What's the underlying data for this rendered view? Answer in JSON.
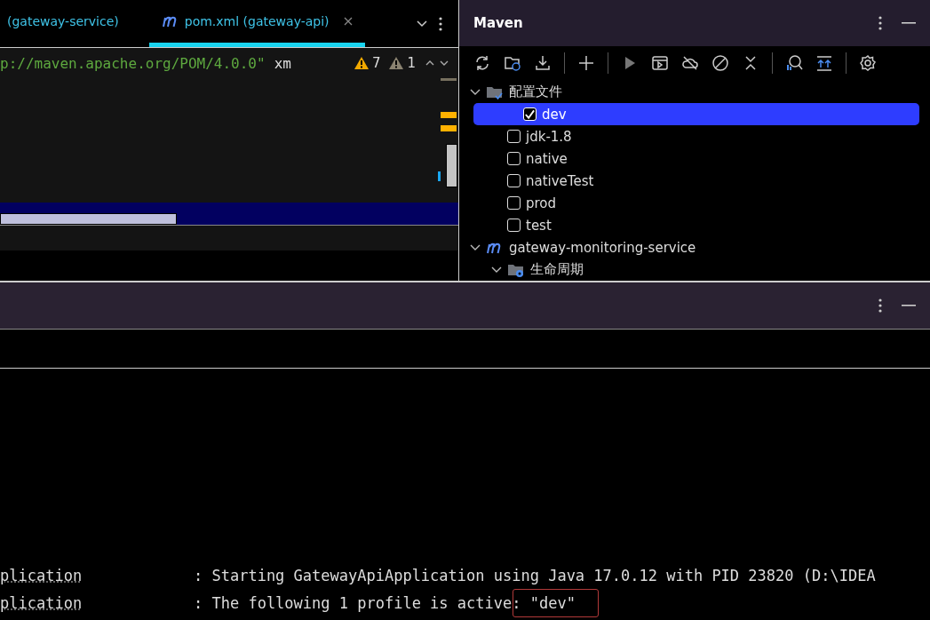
{
  "editor_tabs": [
    {
      "label": "(gateway-service)",
      "selected": false,
      "maven_icon": false
    },
    {
      "label": "pom.xml (gateway-api)",
      "selected": true,
      "maven_icon": true
    }
  ],
  "editor": {
    "code": "p://maven.apache.org/POM/4.0.0\"",
    "code_tail": "xm",
    "warnings": "7",
    "weak_warnings": "1"
  },
  "maven": {
    "title": "Maven",
    "tree": [
      {
        "label": "配置文件",
        "kind": "profiles",
        "expanded": true,
        "children": [
          {
            "label": "dev",
            "kind": "profile",
            "checked": true,
            "selected": true
          },
          {
            "label": "jdk-1.8",
            "kind": "profile",
            "checked": false,
            "selected": false
          },
          {
            "label": "native",
            "kind": "profile",
            "checked": false,
            "selected": false
          },
          {
            "label": "nativeTest",
            "kind": "profile",
            "checked": false,
            "selected": false
          },
          {
            "label": "prod",
            "kind": "profile",
            "checked": false,
            "selected": false
          },
          {
            "label": "test",
            "kind": "profile",
            "checked": false,
            "selected": false
          }
        ]
      },
      {
        "label": "gateway-monitoring-service",
        "kind": "module",
        "expanded": true,
        "children": [
          {
            "label": "生命周期",
            "kind": "lifecycle",
            "expanded": true
          }
        ]
      }
    ]
  },
  "console": {
    "lines": [
      {
        "logger": "plication",
        "message": ": Starting GatewayApiApplication using Java 17.0.12 with PID 23820 (D:\\IDEA",
        "highlighted": false
      },
      {
        "logger": "plication",
        "message": ": The following 1 profile is active: \"dev\"",
        "highlighted": true
      }
    ]
  }
}
